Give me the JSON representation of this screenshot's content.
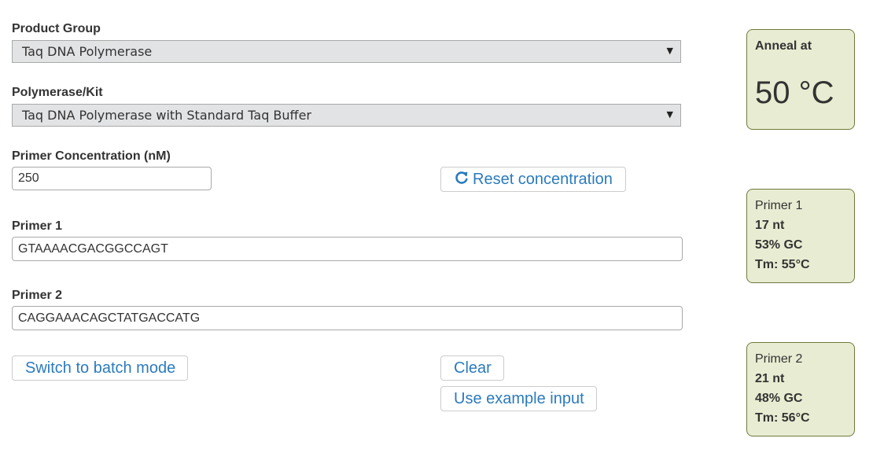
{
  "product_group": {
    "label": "Product Group",
    "selected": "Taq DNA Polymerase"
  },
  "polymerase_kit": {
    "label": "Polymerase/Kit",
    "selected": "Taq DNA Polymerase with Standard Taq Buffer"
  },
  "primer_concentration": {
    "label": "Primer Concentration (nM)",
    "value": "250",
    "reset_label": "Reset concentration"
  },
  "primer1": {
    "label": "Primer 1",
    "value": "GTAAAACGACGGCCAGT"
  },
  "primer2": {
    "label": "Primer 2",
    "value": "CAGGAAACAGCTATGACCATG"
  },
  "buttons": {
    "batch_mode": "Switch to batch mode",
    "clear": "Clear",
    "example": "Use example input"
  },
  "anneal": {
    "title": "Anneal at",
    "value": "50 °C"
  },
  "primer1_stats": {
    "title": "Primer 1",
    "length": "17 nt",
    "gc": "53% GC",
    "tm": "Tm: 55°C"
  },
  "primer2_stats": {
    "title": "Primer 2",
    "length": "21 nt",
    "gc": "48% GC",
    "tm": "Tm: 56°C"
  },
  "colors": {
    "link_blue": "#2b7bbd",
    "panel_bg": "#e8ecd2",
    "panel_border": "#6f7b3a",
    "select_bg": "#e2e3e5"
  },
  "icons": {
    "reset": "refresh-icon",
    "dropdown": "chevron-down-icon"
  }
}
